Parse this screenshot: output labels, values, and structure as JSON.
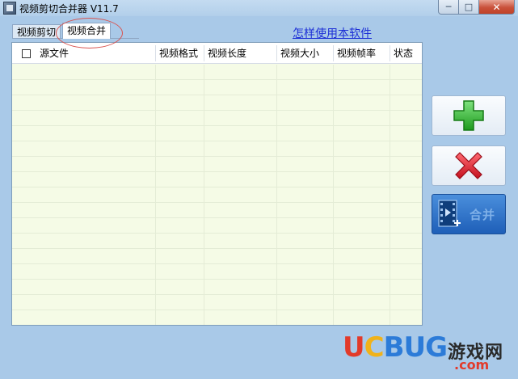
{
  "window": {
    "title": "视频剪切合并器 V11.7",
    "min_glyph": "─",
    "max_glyph": "□",
    "close_glyph": "✕"
  },
  "tabs": [
    {
      "label": "视频剪切",
      "active": false
    },
    {
      "label": "视频合并",
      "active": true
    }
  ],
  "help_link": "怎样使用本软件",
  "table": {
    "columns": [
      "源文件",
      "视频格式",
      "视频长度",
      "视频大小",
      "视频帧率",
      "状态"
    ],
    "rows": []
  },
  "buttons": {
    "merge_label": "合并"
  },
  "colors": {
    "add_icon": "#2fb52f",
    "delete_icon": "#e8283a",
    "merge_button": "#2468c0",
    "table_bg": "#f5fbe6",
    "window_bg": "#a9c9e8"
  },
  "watermark": {
    "brand_u": "U",
    "brand_c": "C",
    "brand_bug": "BUG",
    "site_cn": "游戏网",
    "domain": ".com"
  }
}
